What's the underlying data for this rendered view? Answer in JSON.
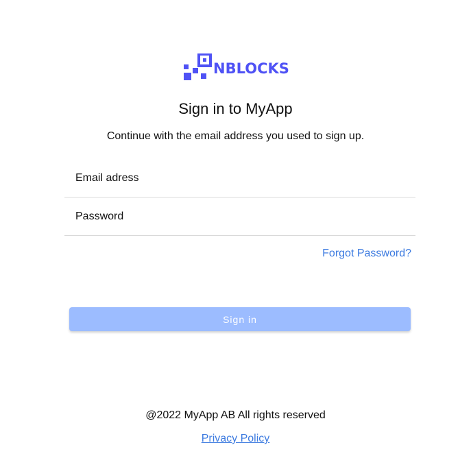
{
  "brand": {
    "name": "NBLOCKS",
    "color": "#4f52f5",
    "icon": "blocks-logo-icon"
  },
  "header": {
    "title": "Sign in to MyApp",
    "subtitle": "Continue with the email address you used to sign up."
  },
  "form": {
    "email_placeholder": "Email adress",
    "email_value": "",
    "password_placeholder": "Password",
    "password_value": "",
    "forgot_password_label": "Forgot Password?",
    "signin_label": "Sign in"
  },
  "footer": {
    "copyright": "@2022 MyApp AB All rights reserved",
    "privacy_label": "Privacy Policy"
  },
  "colors": {
    "link": "#3d7be0",
    "button_disabled": "#9cbcff"
  }
}
